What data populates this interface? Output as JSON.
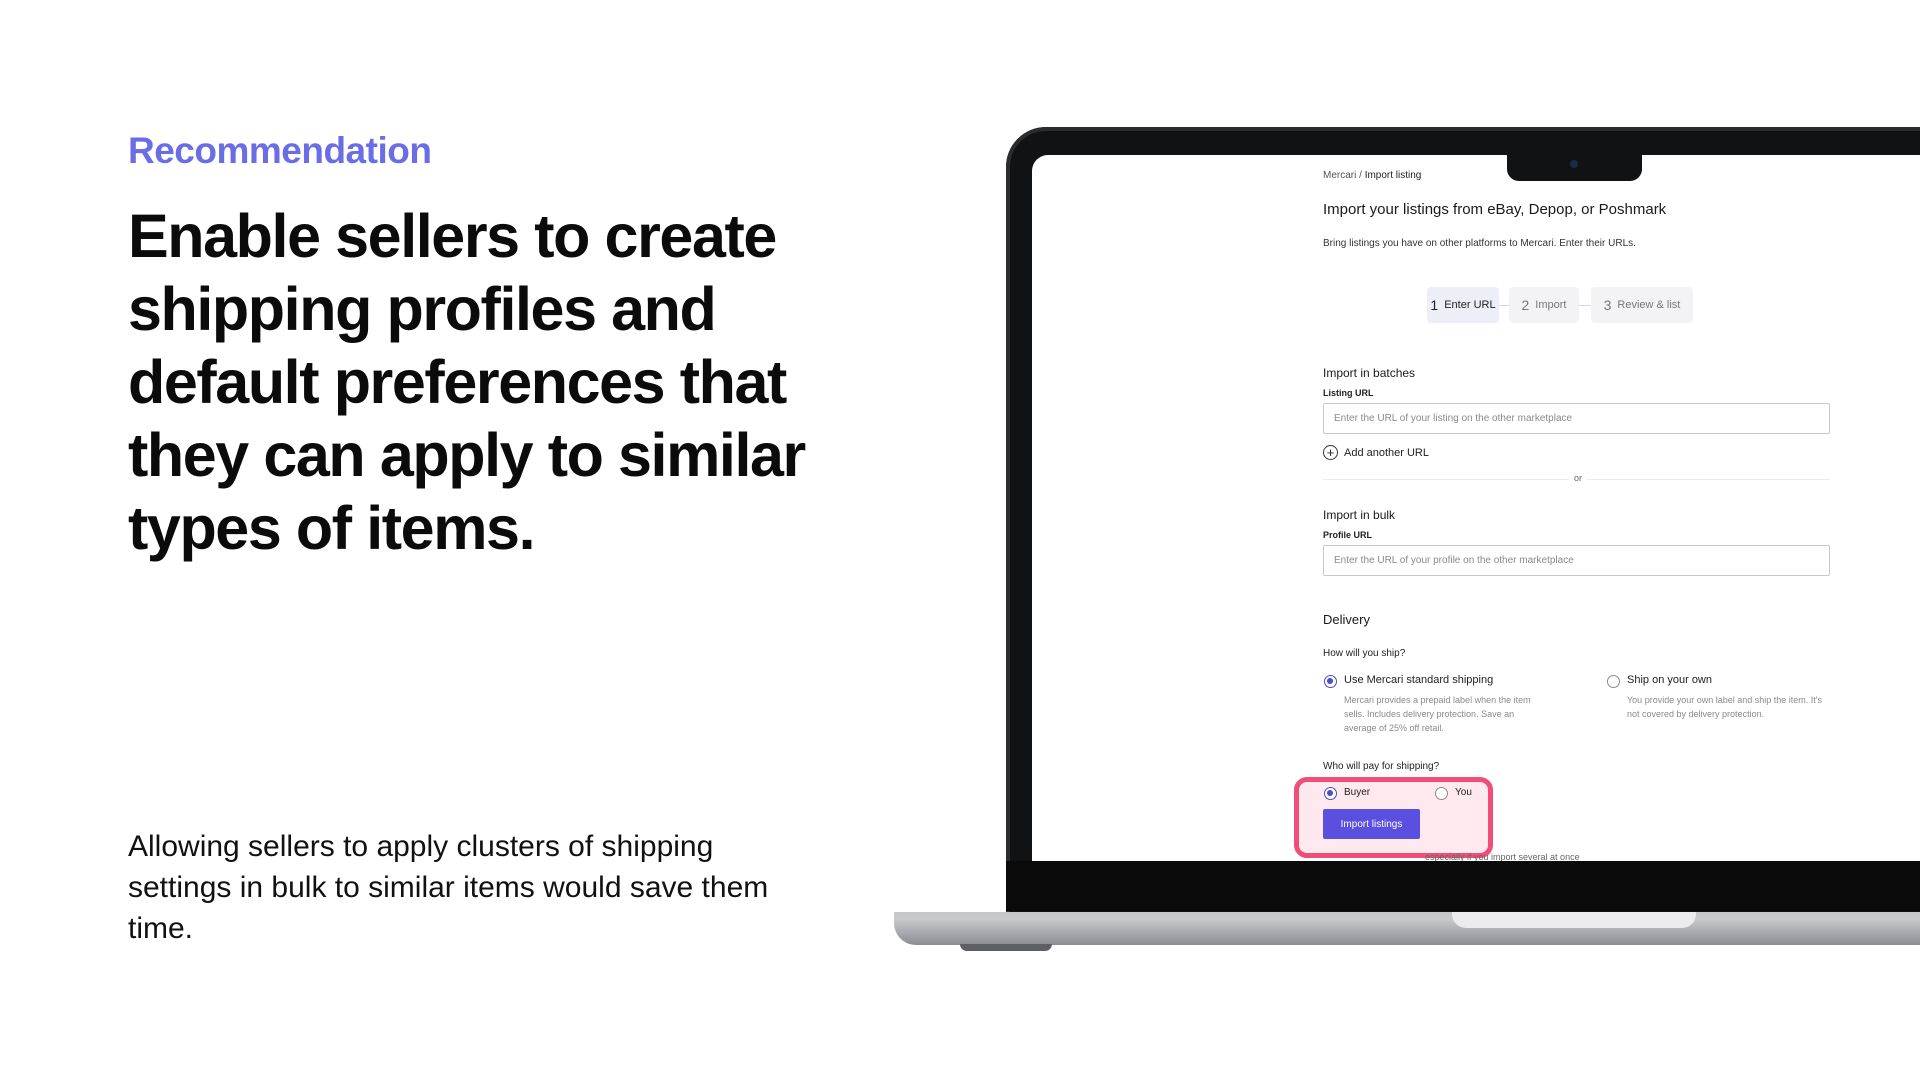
{
  "slide": {
    "eyebrow": "Recommendation",
    "headline": "Enable sellers to create shipping profiles and default preferences that they can apply to similar types of items.",
    "body": "Allowing sellers to apply clusters of shipping settings in bulk to similar items would save them time.",
    "accent_color": "#6a6ee6",
    "highlight_color": "#f04e77"
  },
  "screen": {
    "breadcrumb": {
      "root": "Mercari /",
      "current": "Import listing"
    },
    "title": "Import your listings from eBay, Depop, or Poshmark",
    "subtitle": "Bring listings you have on other platforms to Mercari. Enter their URLs.",
    "steps": [
      {
        "num": "1",
        "label": "Enter URL",
        "active": true
      },
      {
        "num": "2",
        "label": "Import",
        "active": false
      },
      {
        "num": "3",
        "label": "Review & list",
        "active": false
      }
    ],
    "batches": {
      "title": "Import in batches",
      "field_label": "Listing URL",
      "placeholder": "Enter the URL of your listing on the other marketplace",
      "add_label": "Add another URL"
    },
    "or_label": "or",
    "bulk": {
      "title": "Import in bulk",
      "field_label": "Profile URL",
      "placeholder": "Enter the URL of your profile on the other marketplace"
    },
    "delivery": {
      "title": "Delivery",
      "question": "How will you ship?",
      "option_1": {
        "label": "Use Mercari standard shipping",
        "desc": "Mercari provides a prepaid label when the item sells. Includes delivery protection. Save an average of 25% off retail.",
        "selected": true
      },
      "option_2": {
        "label": "Ship on your own",
        "desc": "You provide your own label and ship the item. It's not covered by delivery protection.",
        "selected": false
      },
      "payer_question": "Who will pay for shipping?",
      "payer_buyer": "Buyer",
      "payer_you": "You"
    },
    "import_button": "Import listings",
    "footnote": "especially if you import several at once"
  }
}
